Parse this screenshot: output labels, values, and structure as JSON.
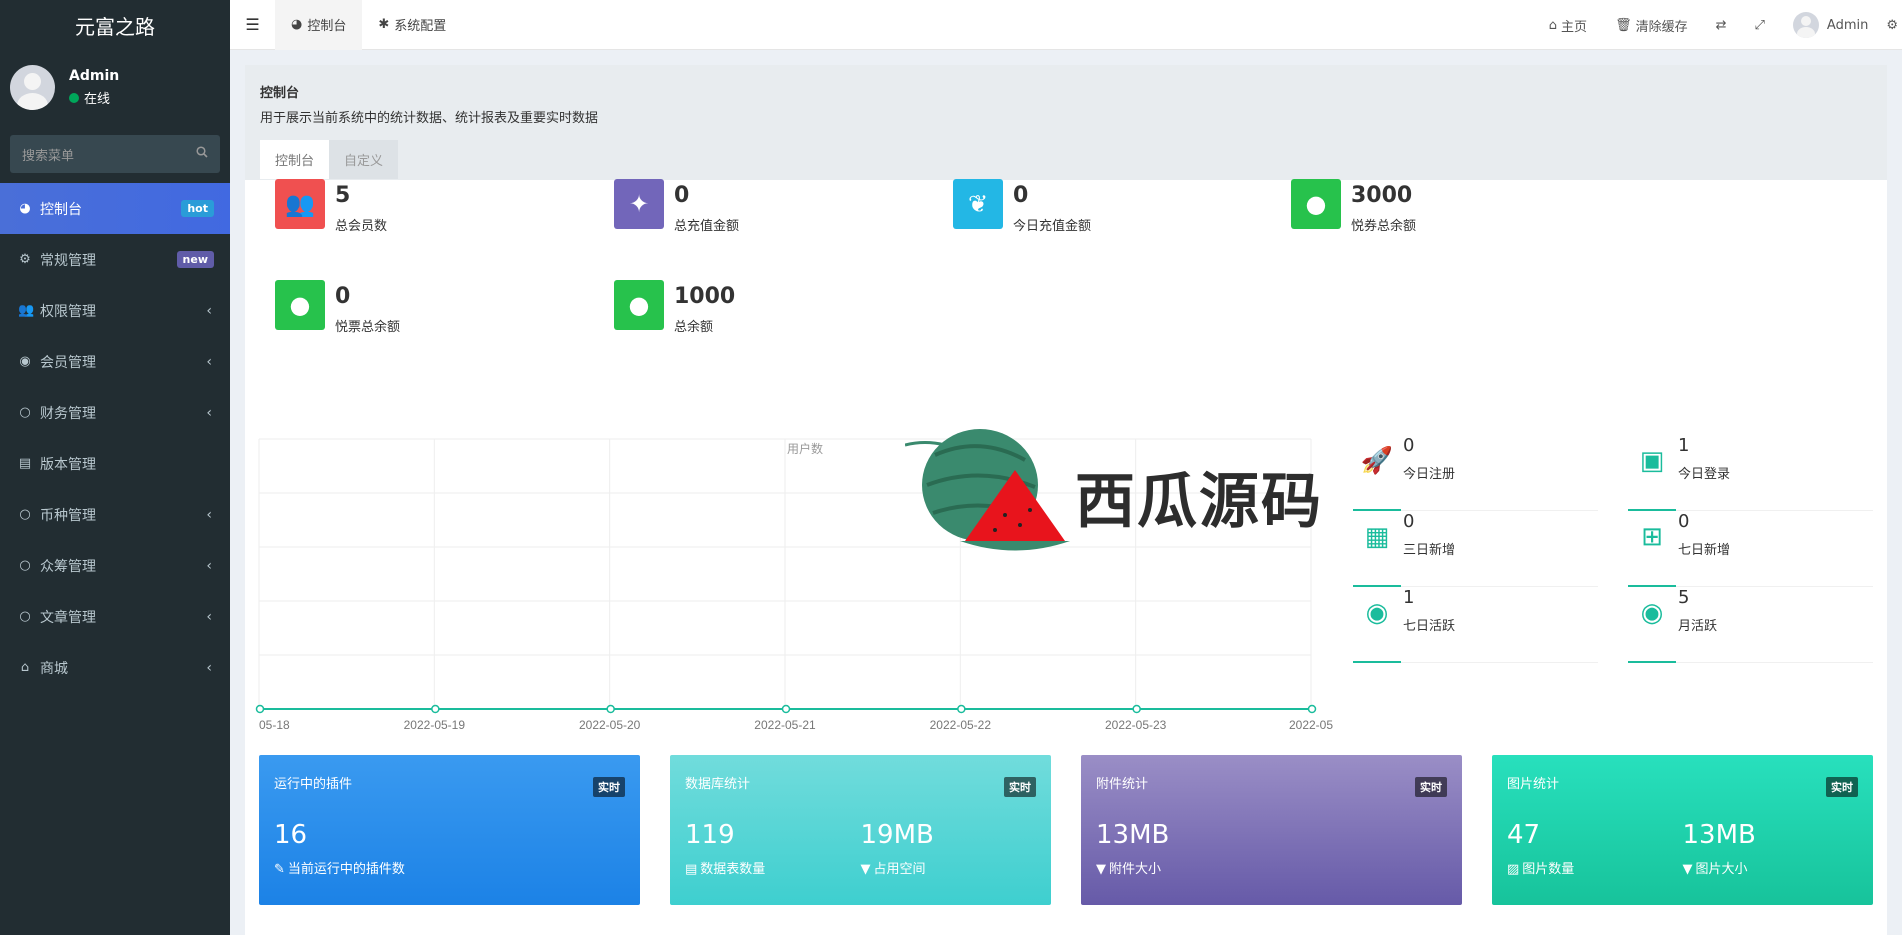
{
  "app": {
    "title": "元富之路"
  },
  "user": {
    "name": "Admin",
    "status": "在线"
  },
  "search": {
    "placeholder": "搜索菜单"
  },
  "sidebar": {
    "items": [
      {
        "label": "控制台",
        "icon": "dashboard-icon",
        "badge": "hot",
        "active": true
      },
      {
        "label": "常规管理",
        "icon": "cogs-icon",
        "badge": "new"
      },
      {
        "label": "权限管理",
        "icon": "group-icon",
        "arrow": "‹"
      },
      {
        "label": "会员管理",
        "icon": "user-circle-icon",
        "arrow": "‹"
      },
      {
        "label": "财务管理",
        "icon": "circle-icon",
        "arrow": "‹"
      },
      {
        "label": "版本管理",
        "icon": "file-icon"
      },
      {
        "label": "币种管理",
        "icon": "circle-icon",
        "arrow": "‹"
      },
      {
        "label": "众筹管理",
        "icon": "circle-icon",
        "arrow": "‹"
      },
      {
        "label": "文章管理",
        "icon": "circle-icon",
        "arrow": "‹"
      },
      {
        "label": "商城",
        "icon": "home-icon",
        "arrow": "‹"
      }
    ]
  },
  "topbar": {
    "tabs": [
      {
        "label": "控制台"
      },
      {
        "label": "系统配置"
      }
    ],
    "right": {
      "home": "主页",
      "clear_cache": "清除缓存",
      "admin": "Admin"
    }
  },
  "header": {
    "title": "控制台",
    "desc": "用于展示当前系统中的统计数据、统计报表及重要实时数据",
    "tabs": [
      {
        "label": "控制台"
      },
      {
        "label": "自定义"
      }
    ]
  },
  "stats": [
    {
      "value": "5",
      "label": "总会员数",
      "color": "#f05050",
      "icon": "users-icon"
    },
    {
      "value": "0",
      "label": "总充值金额",
      "color": "#7266ba",
      "icon": "magic-icon"
    },
    {
      "value": "0",
      "label": "今日充值金额",
      "color": "#23b7e5",
      "icon": "leaf-icon"
    },
    {
      "value": "3000",
      "label": "悦券总余额",
      "color": "#27c24c",
      "icon": "user-icon"
    },
    {
      "value": "0",
      "label": "悦票总余额",
      "color": "#27c24c",
      "icon": "user-icon"
    },
    {
      "value": "1000",
      "label": "总余额",
      "color": "#27c24c",
      "icon": "user-icon"
    }
  ],
  "chart_data": {
    "type": "line",
    "categories": [
      "05-18",
      "2022-05-19",
      "2022-05-20",
      "2022-05-21",
      "2022-05-22",
      "2022-05-23",
      "2022-05"
    ],
    "series": [
      {
        "name": "用户数",
        "values": [
          0,
          0,
          0,
          0,
          0,
          0,
          0
        ]
      }
    ],
    "grid": true,
    "color": "#1abc9c"
  },
  "right_stats": [
    {
      "value": "0",
      "label": "今日注册",
      "icon": "rocket-icon"
    },
    {
      "value": "1",
      "label": "今日登录",
      "icon": "vcard-icon"
    },
    {
      "value": "0",
      "label": "三日新增",
      "icon": "calendar-icon"
    },
    {
      "value": "0",
      "label": "七日新增",
      "icon": "calendar-plus-icon"
    },
    {
      "value": "1",
      "label": "七日活跃",
      "icon": "user-circle-icon"
    },
    {
      "value": "5",
      "label": "月活跃",
      "icon": "user-circle-icon"
    }
  ],
  "cards": [
    {
      "title": "运行中的插件",
      "tag": "实时",
      "cols": [
        {
          "value": "16",
          "sub": "当前运行中的插件数",
          "icon": "magic-icon"
        }
      ],
      "gradient": [
        "#3a9af0",
        "#1c82e6"
      ]
    },
    {
      "title": "数据库统计",
      "tag": "实时",
      "cols": [
        {
          "value": "119",
          "sub": "数据表数量",
          "icon": "database-icon"
        },
        {
          "value": "19MB",
          "sub": "占用空间",
          "icon": "filter-icon"
        }
      ],
      "gradient": [
        "#71dcdc",
        "#3ecfcf"
      ]
    },
    {
      "title": "附件统计",
      "tag": "实时",
      "cols": [
        {
          "value": "13MB",
          "sub": "附件大小",
          "icon": "filter-icon"
        }
      ],
      "gradient": [
        "#9a8ec6",
        "#665aa8"
      ]
    },
    {
      "title": "图片统计",
      "tag": "实时",
      "cols": [
        {
          "value": "47",
          "sub": "图片数量",
          "icon": "image-icon"
        },
        {
          "value": "13MB",
          "sub": "图片大小",
          "icon": "filter-icon"
        }
      ],
      "gradient": [
        "#28e0bd",
        "#17c39b"
      ]
    }
  ],
  "watermark": {
    "text": "西瓜源码"
  }
}
